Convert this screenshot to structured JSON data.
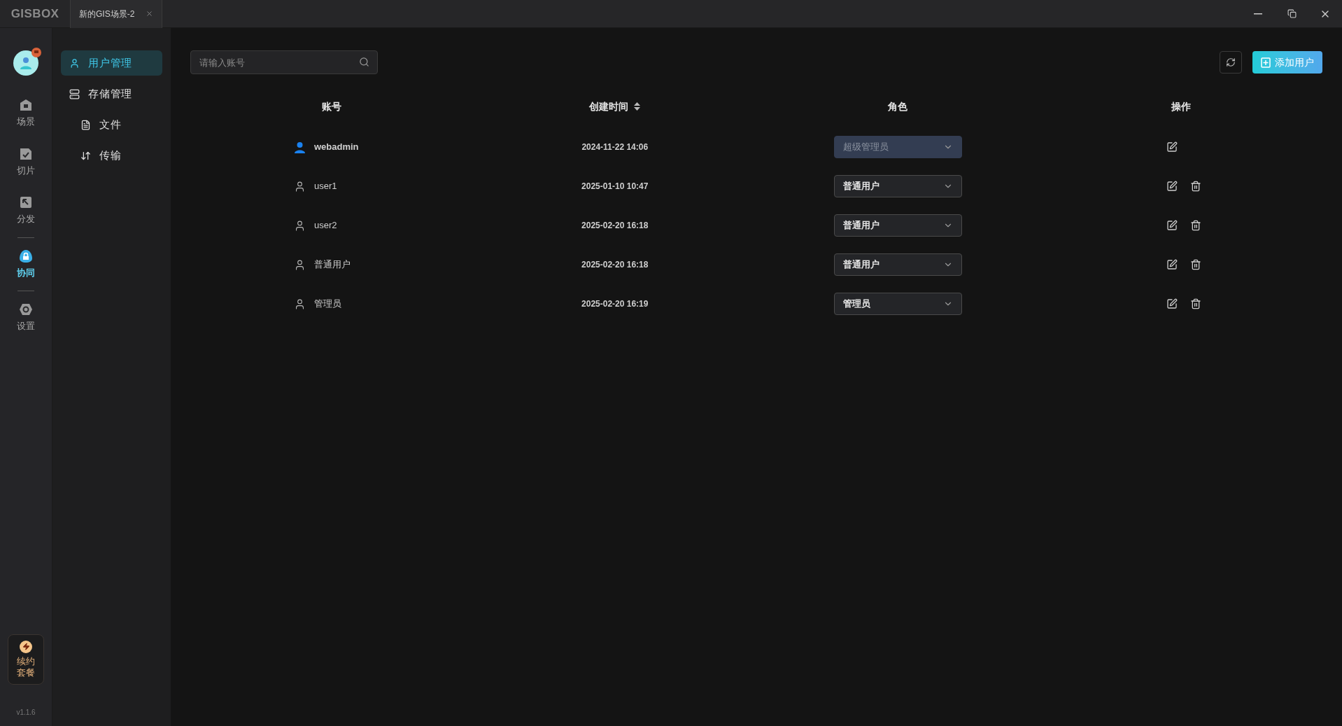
{
  "titlebar": {
    "logo": "GISBOX",
    "tabs": [
      {
        "label": "新的GIS场景-2",
        "selected": true
      }
    ]
  },
  "rail": {
    "groups": [
      [
        {
          "label": "场景",
          "selected": false
        },
        {
          "label": "切片",
          "selected": false
        },
        {
          "label": "分发",
          "selected": false
        }
      ],
      [
        {
          "label": "协同",
          "selected": true
        }
      ],
      [
        {
          "label": "设置",
          "selected": false
        }
      ]
    ],
    "renew": {
      "label": "续约套餐"
    },
    "version": "v1.1.6"
  },
  "sidebar": {
    "items": [
      {
        "label": "用户管理",
        "selected": true
      },
      {
        "label": "存储管理",
        "selected": false,
        "children": [
          {
            "label": "文件",
            "selected": false
          },
          {
            "label": "传输",
            "selected": false
          }
        ]
      }
    ]
  },
  "search": {
    "placeholder": "请输入账号"
  },
  "add_button": "添加用户",
  "table": {
    "columns": [
      {
        "label": "账号",
        "sortable": false
      },
      {
        "label": "创建时间",
        "sortable": true
      },
      {
        "label": "角色",
        "sortable": false
      },
      {
        "label": "操作",
        "sortable": false
      }
    ],
    "rows": [
      {
        "account": "webadmin",
        "current": true,
        "created": "2024-11-22 14:06",
        "role": "超级管理员",
        "disabled": true,
        "deletable": false
      },
      {
        "account": "user1",
        "current": false,
        "created": "2025-01-10 10:47",
        "role": "普通用户",
        "disabled": false,
        "deletable": true
      },
      {
        "account": "user2",
        "current": false,
        "created": "2025-02-20 16:18",
        "role": "普通用户",
        "disabled": false,
        "deletable": true
      },
      {
        "account": "普通用户",
        "current": false,
        "created": "2025-02-20 16:18",
        "role": "普通用户",
        "disabled": false,
        "deletable": true
      },
      {
        "account": "管理员",
        "current": false,
        "created": "2025-02-20 16:19",
        "role": "管理员",
        "disabled": false,
        "deletable": true
      }
    ]
  }
}
